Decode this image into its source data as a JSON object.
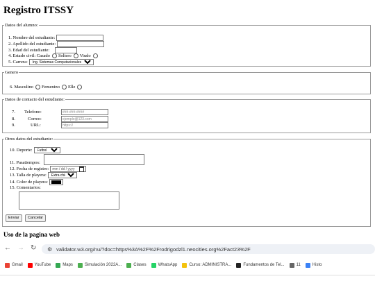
{
  "title": "Registro ITSSY",
  "alumno": {
    "legend": "Datos del alumno:",
    "nombre": "1. Nombre del estudiante:",
    "apellido": "2. Apellido del estudiante:",
    "edad": "3. Edad del estudiante:",
    "estado": "4. Estado civil: Casado",
    "soltero": "Soltero",
    "viudo": "Viudo",
    "carrera": "5. Carrera:",
    "carrera_value": "Ing. Sistemas Computacionales"
  },
  "genero": {
    "legend": "Genero",
    "label": "6. Masculino",
    "femenino": "Femenino",
    "elle": "Elle"
  },
  "contacto": {
    "legend": "Datos de contacto del estudiante:",
    "telefono_num": "7.",
    "telefono": "Telefono:",
    "telefono_ph": "###-###-####",
    "correo_num": "8.",
    "correo": "Correo:",
    "correo_ph": "ejemplo@123.com",
    "url_num": "9.",
    "url": "URL:",
    "url_ph": "https://"
  },
  "otros": {
    "legend": "Otros datos del estudiante:",
    "deporte": "10. Deporte:",
    "deporte_value": "Futbol",
    "pasatiempos": "11. Pasatiempos:",
    "fecha": "12. Fecha de registro:",
    "fecha_ph": "mm / dd / yyyy",
    "talla": "13. Talla de playera:",
    "talla_value": "Extra chica",
    "color": "14. Color de playera:",
    "comentarios": "15. Comentarios:",
    "enviar": "Enviar",
    "cancelar": "Cancelar"
  },
  "uso": "Uso de la pagina web",
  "browser": {
    "url": "validator.w3.org/nu/?doc=https%3A%2F%2Frodrigodzl1.neocities.org%2Fact23%2F",
    "bookmarks": [
      {
        "label": "Gmail",
        "color": "#ea4335"
      },
      {
        "label": "YouTube",
        "color": "#ff0000"
      },
      {
        "label": "Maps",
        "color": "#34a853"
      },
      {
        "label": "Simulación 2022A...",
        "color": "#4caf50"
      },
      {
        "label": "Clases",
        "color": "#4caf50"
      },
      {
        "label": "WhatsApp",
        "color": "#25d366"
      },
      {
        "label": "Curso: ADMINISTRA...",
        "color": "#f4c20d"
      },
      {
        "label": "Fundamentos de Tel...",
        "color": "#222222"
      },
      {
        "label": "11",
        "color": "#666666"
      },
      {
        "label": "Histo",
        "color": "#3b82f6"
      }
    ]
  }
}
